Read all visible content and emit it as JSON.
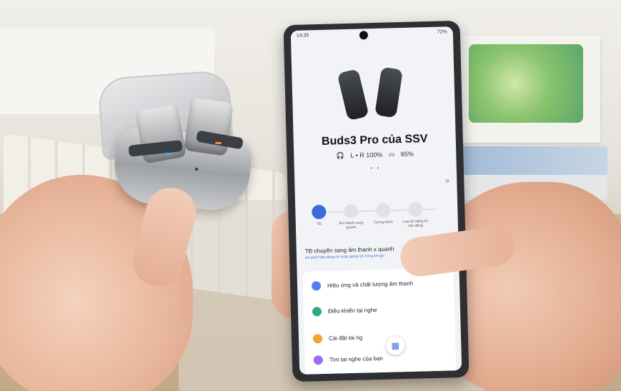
{
  "phone": {
    "time": "14:35",
    "status_right": "72%",
    "device_name": "Buds3 Pro của SSV",
    "battery_buds": "L • R 100%",
    "battery_case": "65%",
    "page_dots": "• •",
    "modes": [
      {
        "label": "Tắt",
        "active": true
      },
      {
        "label": "Âm thanh xung quanh",
        "active": false
      },
      {
        "label": "Tương thích",
        "active": false
      },
      {
        "label": "Loại bỏ tiếng ồn chủ động",
        "active": false
      }
    ],
    "ambient_title": "TĐ chuyển sang âm thanh x quanh",
    "ambient_subtitle": "khi phát hiện tiếng cồi hoặc giọng nói trong khi gọi",
    "menu": [
      {
        "label": "Hiệu ứng và chất lượng âm thanh",
        "icon": "sound-icon",
        "color": "#5b7cf0"
      },
      {
        "label": "Điều khiển tai nghe",
        "icon": "earbud-control-icon",
        "color": "#2eaa8a"
      },
      {
        "label": "Cài đặt tai ng",
        "icon": "settings-icon",
        "color": "#f0a431"
      },
      {
        "label": "Tìm tai nghe của bạn",
        "icon": "find-icon",
        "color": "#9b6cf0"
      }
    ],
    "fab_icon": "grid-icon"
  }
}
